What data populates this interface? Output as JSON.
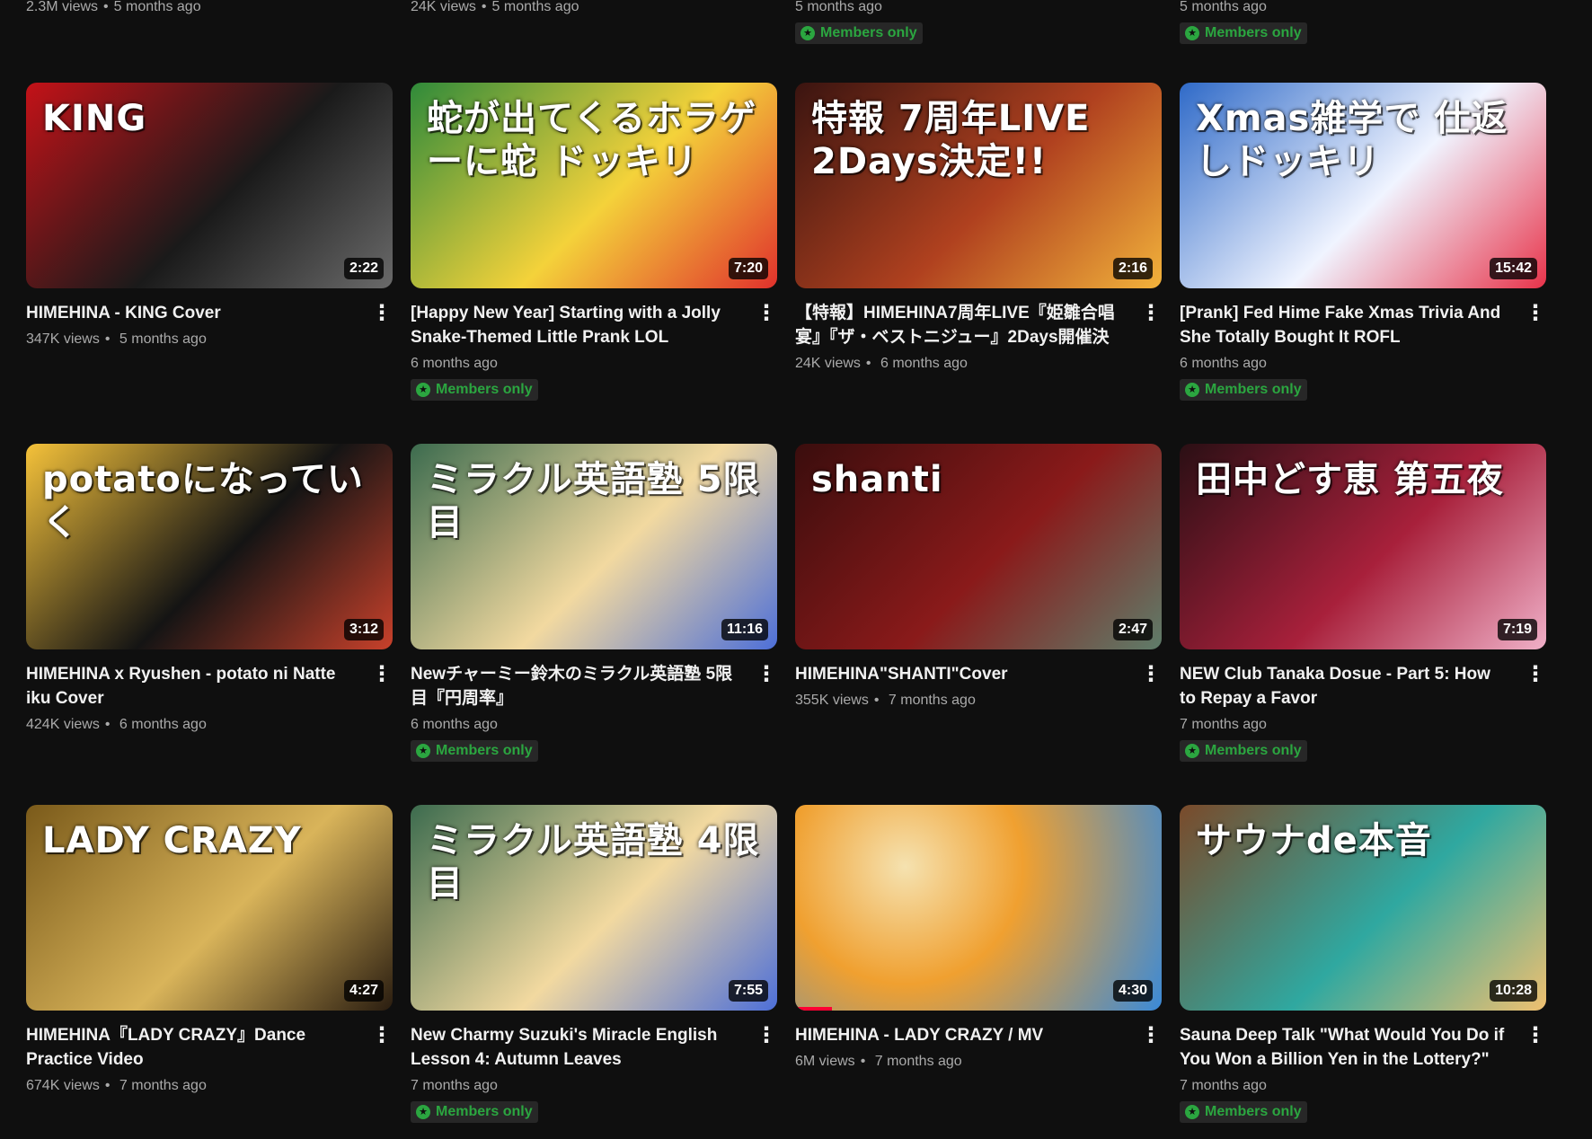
{
  "top_row": [
    {
      "views": "2.3M views",
      "age": "5 months ago",
      "members_only": false
    },
    {
      "views": "24K views",
      "age": "5 months ago",
      "members_only": false
    },
    {
      "views": "",
      "age": "5 months ago",
      "members_only": true
    },
    {
      "views": "",
      "age": "5 months ago",
      "members_only": true
    }
  ],
  "labels": {
    "members_only": "Members only",
    "more_actions": "⋮",
    "separator": "•",
    "members_star": "★"
  },
  "videos": [
    {
      "title": "HIMEHINA - KING Cover",
      "views": "347K views",
      "age": "5 months ago",
      "duration": "2:22",
      "members_only": false,
      "thumb_text": "KING",
      "colors": [
        "#c41218",
        "#1a1a1a",
        "#6a6a6a"
      ]
    },
    {
      "title": "[Happy New Year] Starting with a Jolly Snake-Themed Little Prank LOL",
      "views": "",
      "age": "6 months ago",
      "duration": "7:20",
      "members_only": true,
      "thumb_text": "蛇が出てくるホラゲーに蛇 ドッキリ",
      "colors": [
        "#2f8a3a",
        "#f4d23a",
        "#e0312c"
      ]
    },
    {
      "title": "【特報】HIMEHINA7周年LIVE『姫雛合唱宴』『ザ・ベストニジュー』2Days開催決定！",
      "views": "24K views",
      "age": "6 months ago",
      "duration": "2:16",
      "members_only": false,
      "thumb_text": "特報 7周年LIVE 2Days決定!!",
      "colors": [
        "#3a1410",
        "#b0411f",
        "#f2b23b"
      ]
    },
    {
      "title": "[Prank] Fed Hime Fake Xmas Trivia And She Totally Bought It ROFL",
      "views": "",
      "age": "6 months ago",
      "duration": "15:42",
      "members_only": true,
      "thumb_text": "Xmas雑学で 仕返しドッキリ",
      "colors": [
        "#2f6ac8",
        "#f0f4ff",
        "#e8334a"
      ]
    },
    {
      "title": "HIMEHINA x Ryushen - potato ni Natte iku Cover",
      "views": "424K views",
      "age": "6 months ago",
      "duration": "3:12",
      "members_only": false,
      "thumb_text": "potatoになっていく",
      "colors": [
        "#f5c23a",
        "#141414",
        "#c8412b"
      ]
    },
    {
      "title": "Newチャーミー鈴木のミラクル英語塾 5限目『円周率』",
      "views": "",
      "age": "6 months ago",
      "duration": "11:16",
      "members_only": true,
      "thumb_text": "ミラクル英語塾 5限目",
      "colors": [
        "#3c6b4e",
        "#f2d9a0",
        "#4d6fd8"
      ]
    },
    {
      "title": "HIMEHINA\"SHANTI\"Cover",
      "views": "355K views",
      "age": "7 months ago",
      "duration": "2:47",
      "members_only": false,
      "thumb_text": "shanti",
      "colors": [
        "#3a0d0d",
        "#8a1a1a",
        "#5f7d6a"
      ]
    },
    {
      "title": "NEW Club Tanaka Dosue - Part 5: How to Repay a Favor",
      "views": "",
      "age": "7 months ago",
      "duration": "7:19",
      "members_only": true,
      "thumb_text": "田中どす恵 第五夜",
      "colors": [
        "#2a0f14",
        "#a8203b",
        "#f0b0c8"
      ]
    },
    {
      "title": "HIMEHINA『LADY CRAZY』Dance Practice Video",
      "views": "674K views",
      "age": "7 months ago",
      "duration": "4:27",
      "members_only": false,
      "thumb_text": "LADY CRAZY",
      "colors": [
        "#7a5a1a",
        "#d9b45a",
        "#2a1d10"
      ]
    },
    {
      "title": "New Charmy Suzuki's Miracle English Lesson 4: Autumn Leaves",
      "views": "",
      "age": "7 months ago",
      "duration": "7:55",
      "members_only": true,
      "thumb_text": "ミラクル英語塾 4限目",
      "colors": [
        "#3c6b4e",
        "#f2d9a0",
        "#4d6fd8"
      ]
    },
    {
      "title": "HIMEHINA - LADY CRAZY / MV",
      "views": "6M views",
      "age": "7 months ago",
      "duration": "4:30",
      "members_only": false,
      "thumb_text": "",
      "colors": [
        "#f0a030",
        "#3a8ad8",
        "#f5e2b0"
      ]
    },
    {
      "title": "Sauna Deep Talk \"What Would You Do if You Won a Billion Yen in the Lottery?\"",
      "views": "",
      "age": "7 months ago",
      "duration": "10:28",
      "members_only": true,
      "thumb_text": "サウナde本音",
      "colors": [
        "#7a4a2a",
        "#2fa8a0",
        "#f0c070"
      ]
    }
  ]
}
